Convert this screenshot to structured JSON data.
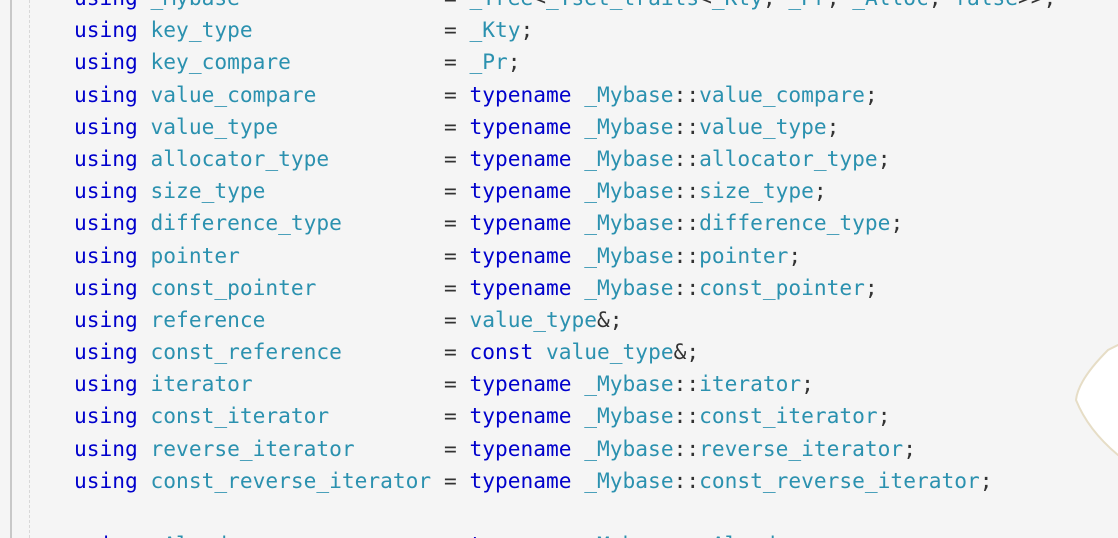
{
  "editor": {
    "lines": [
      {
        "kw": "using",
        "name": "_Mybase",
        "pad": "                ",
        "eq": "= ",
        "rhs_parts": [
          {
            "cls": "ty",
            "text": "_Tree"
          },
          {
            "cls": "op",
            "text": "<"
          },
          {
            "cls": "ty",
            "text": "_Tset_traits"
          },
          {
            "cls": "op",
            "text": "<"
          },
          {
            "cls": "ty",
            "text": "_Kty"
          },
          {
            "cls": "op",
            "text": ", "
          },
          {
            "cls": "ty",
            "text": "_Pr"
          },
          {
            "cls": "op",
            "text": ", "
          },
          {
            "cls": "ty",
            "text": "_Alloc"
          },
          {
            "cls": "op",
            "text": ", "
          },
          {
            "cls": "ty",
            "text": "false"
          },
          {
            "cls": "op",
            "text": ">>;"
          }
        ]
      },
      {
        "kw": "using",
        "name": "key_type",
        "pad": "               ",
        "eq": "= ",
        "rhs_parts": [
          {
            "cls": "ty",
            "text": "_Kty"
          },
          {
            "cls": "op",
            "text": ";"
          }
        ]
      },
      {
        "kw": "using",
        "name": "key_compare",
        "pad": "            ",
        "eq": "= ",
        "rhs_parts": [
          {
            "cls": "ty",
            "text": "_Pr"
          },
          {
            "cls": "op",
            "text": ";"
          }
        ]
      },
      {
        "kw": "using",
        "name": "value_compare",
        "pad": "          ",
        "eq": "= ",
        "rhs_parts": [
          {
            "cls": "kw",
            "text": "typename "
          },
          {
            "cls": "ty",
            "text": "_Mybase"
          },
          {
            "cls": "op",
            "text": "::"
          },
          {
            "cls": "ty",
            "text": "value_compare"
          },
          {
            "cls": "op",
            "text": ";"
          }
        ]
      },
      {
        "kw": "using",
        "name": "value_type",
        "pad": "             ",
        "eq": "= ",
        "rhs_parts": [
          {
            "cls": "kw",
            "text": "typename "
          },
          {
            "cls": "ty",
            "text": "_Mybase"
          },
          {
            "cls": "op",
            "text": "::"
          },
          {
            "cls": "ty",
            "text": "value_type"
          },
          {
            "cls": "op",
            "text": ";"
          }
        ]
      },
      {
        "kw": "using",
        "name": "allocator_type",
        "pad": "         ",
        "eq": "= ",
        "rhs_parts": [
          {
            "cls": "kw",
            "text": "typename "
          },
          {
            "cls": "ty",
            "text": "_Mybase"
          },
          {
            "cls": "op",
            "text": "::"
          },
          {
            "cls": "ty",
            "text": "allocator_type"
          },
          {
            "cls": "op",
            "text": ";"
          }
        ]
      },
      {
        "kw": "using",
        "name": "size_type",
        "pad": "              ",
        "eq": "= ",
        "rhs_parts": [
          {
            "cls": "kw",
            "text": "typename "
          },
          {
            "cls": "ty",
            "text": "_Mybase"
          },
          {
            "cls": "op",
            "text": "::"
          },
          {
            "cls": "ty",
            "text": "size_type"
          },
          {
            "cls": "op",
            "text": ";"
          }
        ]
      },
      {
        "kw": "using",
        "name": "difference_type",
        "pad": "        ",
        "eq": "= ",
        "rhs_parts": [
          {
            "cls": "kw",
            "text": "typename "
          },
          {
            "cls": "ty",
            "text": "_Mybase"
          },
          {
            "cls": "op",
            "text": "::"
          },
          {
            "cls": "ty",
            "text": "difference_type"
          },
          {
            "cls": "op",
            "text": ";"
          }
        ]
      },
      {
        "kw": "using",
        "name": "pointer",
        "pad": "                ",
        "eq": "= ",
        "rhs_parts": [
          {
            "cls": "kw",
            "text": "typename "
          },
          {
            "cls": "ty",
            "text": "_Mybase"
          },
          {
            "cls": "op",
            "text": "::"
          },
          {
            "cls": "ty",
            "text": "pointer"
          },
          {
            "cls": "op",
            "text": ";"
          }
        ]
      },
      {
        "kw": "using",
        "name": "const_pointer",
        "pad": "          ",
        "eq": "= ",
        "rhs_parts": [
          {
            "cls": "kw",
            "text": "typename "
          },
          {
            "cls": "ty",
            "text": "_Mybase"
          },
          {
            "cls": "op",
            "text": "::"
          },
          {
            "cls": "ty",
            "text": "const_pointer"
          },
          {
            "cls": "op",
            "text": ";"
          }
        ]
      },
      {
        "kw": "using",
        "name": "reference",
        "pad": "              ",
        "eq": "= ",
        "rhs_parts": [
          {
            "cls": "ty",
            "text": "value_type"
          },
          {
            "cls": "op",
            "text": "&;"
          }
        ]
      },
      {
        "kw": "using",
        "name": "const_reference",
        "pad": "        ",
        "eq": "= ",
        "rhs_parts": [
          {
            "cls": "kw",
            "text": "const "
          },
          {
            "cls": "ty",
            "text": "value_type"
          },
          {
            "cls": "op",
            "text": "&;"
          }
        ]
      },
      {
        "kw": "using",
        "name": "iterator",
        "pad": "               ",
        "eq": "= ",
        "rhs_parts": [
          {
            "cls": "kw",
            "text": "typename "
          },
          {
            "cls": "ty",
            "text": "_Mybase"
          },
          {
            "cls": "op",
            "text": "::"
          },
          {
            "cls": "ty",
            "text": "iterator"
          },
          {
            "cls": "op",
            "text": ";"
          }
        ]
      },
      {
        "kw": "using",
        "name": "const_iterator",
        "pad": "         ",
        "eq": "= ",
        "rhs_parts": [
          {
            "cls": "kw",
            "text": "typename "
          },
          {
            "cls": "ty",
            "text": "_Mybase"
          },
          {
            "cls": "op",
            "text": "::"
          },
          {
            "cls": "ty",
            "text": "const_iterator"
          },
          {
            "cls": "op",
            "text": ";"
          }
        ]
      },
      {
        "kw": "using",
        "name": "reverse_iterator",
        "pad": "       ",
        "eq": "= ",
        "rhs_parts": [
          {
            "cls": "kw",
            "text": "typename "
          },
          {
            "cls": "ty",
            "text": "_Mybase"
          },
          {
            "cls": "op",
            "text": "::"
          },
          {
            "cls": "ty",
            "text": "reverse_iterator"
          },
          {
            "cls": "op",
            "text": ";"
          }
        ]
      },
      {
        "kw": "using",
        "name": "const_reverse_iterator",
        "pad": " ",
        "eq": "= ",
        "rhs_parts": [
          {
            "cls": "kw",
            "text": "typename "
          },
          {
            "cls": "ty",
            "text": "_Mybase"
          },
          {
            "cls": "op",
            "text": "::"
          },
          {
            "cls": "ty",
            "text": "const_reverse_iterator"
          },
          {
            "cls": "op",
            "text": ";"
          }
        ]
      },
      {
        "blank": true
      },
      {
        "kw": "using",
        "name": "_Alnode",
        "pad": "                ",
        "eq": "= ",
        "rhs_parts": [
          {
            "cls": "kw",
            "text": "typename "
          },
          {
            "cls": "ty",
            "text": "_Mybase"
          },
          {
            "cls": "op",
            "text": "::"
          },
          {
            "cls": "ty",
            "text": "_Alnode"
          },
          {
            "cls": "op",
            "text": ";"
          }
        ]
      }
    ]
  }
}
